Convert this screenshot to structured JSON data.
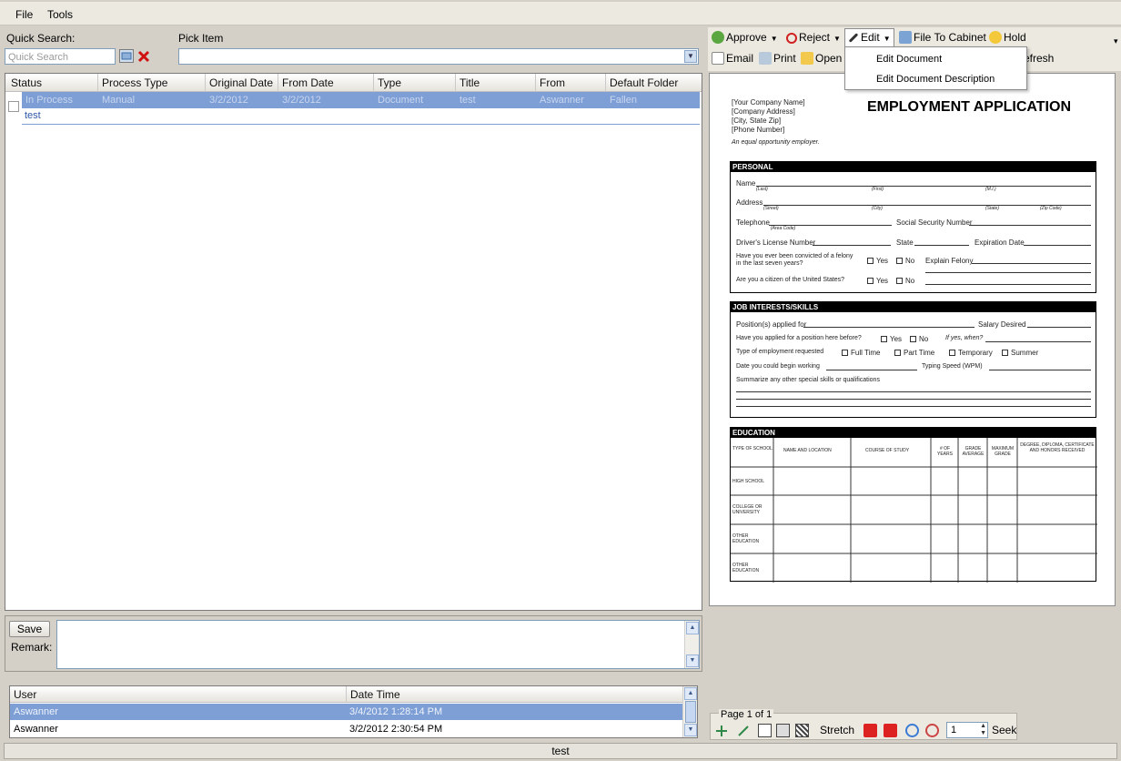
{
  "menu": {
    "file": "File",
    "tools": "Tools"
  },
  "search": {
    "label": "Quick Search:",
    "placeholder": "Quick Search",
    "pick_label": "Pick Item"
  },
  "grid": {
    "columns": [
      "Status",
      "Process Type",
      "Original Date",
      "From Date",
      "Type",
      "Title",
      "From",
      "Default Folder"
    ],
    "row": [
      "In Process",
      "Manual",
      "3/2/2012",
      "3/2/2012",
      "Document",
      "test",
      "Aswanner",
      "Fallen"
    ],
    "subrow": "test"
  },
  "remark": {
    "save": "Save",
    "label": "Remark:"
  },
  "history": {
    "columns": [
      "User",
      "Date Time"
    ],
    "rows": [
      {
        "user": "Aswanner",
        "time": "3/4/2012 1:28:14 PM"
      },
      {
        "user": "Aswanner",
        "time": "3/2/2012 2:30:54 PM"
      }
    ]
  },
  "toolbar": {
    "approve": "Approve",
    "reject": "Reject",
    "edit": "Edit",
    "file_to_cabinet": "File To Cabinet",
    "hold": "Hold",
    "email": "Email",
    "print": "Print",
    "open": "Open",
    "refresh": "efresh"
  },
  "edit_menu": {
    "item1": "Edit Document",
    "item2": "Edit Document Description"
  },
  "document": {
    "company": "[Your Company Name]",
    "address": "[Company Address]",
    "city": "[City, State  Zip]",
    "phone": "[Phone Number]",
    "eeo": "An equal opportunity employer.",
    "title": "EMPLOYMENT APPLICATION",
    "sec_personal": "PERSONAL",
    "name": "Name",
    "last": "(Last)",
    "first": "(First)",
    "mi": "(M.I.)",
    "address_l": "Address",
    "street": "(Street)",
    "city_l": "(City)",
    "state_l": "(State)",
    "zip_l": "(Zip Code)",
    "telephone": "Telephone",
    "area_code": "(Area Code)",
    "ssn": "Social Security Number",
    "license": "Driver's License Number",
    "state": "State",
    "exp": "Expiration Date",
    "felony1": "Have you ever been convicted of a felony",
    "felony2": "in the last seven years?",
    "yes": "Yes",
    "no": "No",
    "explain": "Explain Felony",
    "citizen": "Are you a citizen of the United States?",
    "sec_job": "JOB INTERESTS/SKILLS",
    "position": "Position(s) applied for",
    "salary": "Salary Desired",
    "applied": "Have you applied for a position here before?",
    "ifyes": "If yes, when?",
    "emp_type": "Type of employment requested",
    "full": "Full Time",
    "part": "Part Time",
    "temp": "Temporary",
    "summer": "Summer",
    "date_begin": "Date you could begin working",
    "typing": "Typing Speed (WPM)",
    "summarize": "Summarize any other special skills or qualifications",
    "sec_edu": "EDUCATION",
    "edu_cols": [
      "TYPE OF SCHOOL",
      "NAME AND LOCATION",
      "COURSE OF STUDY",
      "# OF YEARS",
      "GRADE AVERAGE",
      "MAXIMUM GRADE",
      "DEGREE, DIPLOMA, CERTIFICATE AND HONORS RECEIVED"
    ],
    "edu_rows": [
      "HIGH SCHOOL",
      "COLLEGE OR UNIVERSITY",
      "OTHER EDUCATION",
      "OTHER EDUCATION"
    ]
  },
  "pager": {
    "page": "Page 1 of 1",
    "stretch": "Stretch",
    "num": "1",
    "seek": "Seek"
  },
  "status": {
    "text": "test"
  }
}
